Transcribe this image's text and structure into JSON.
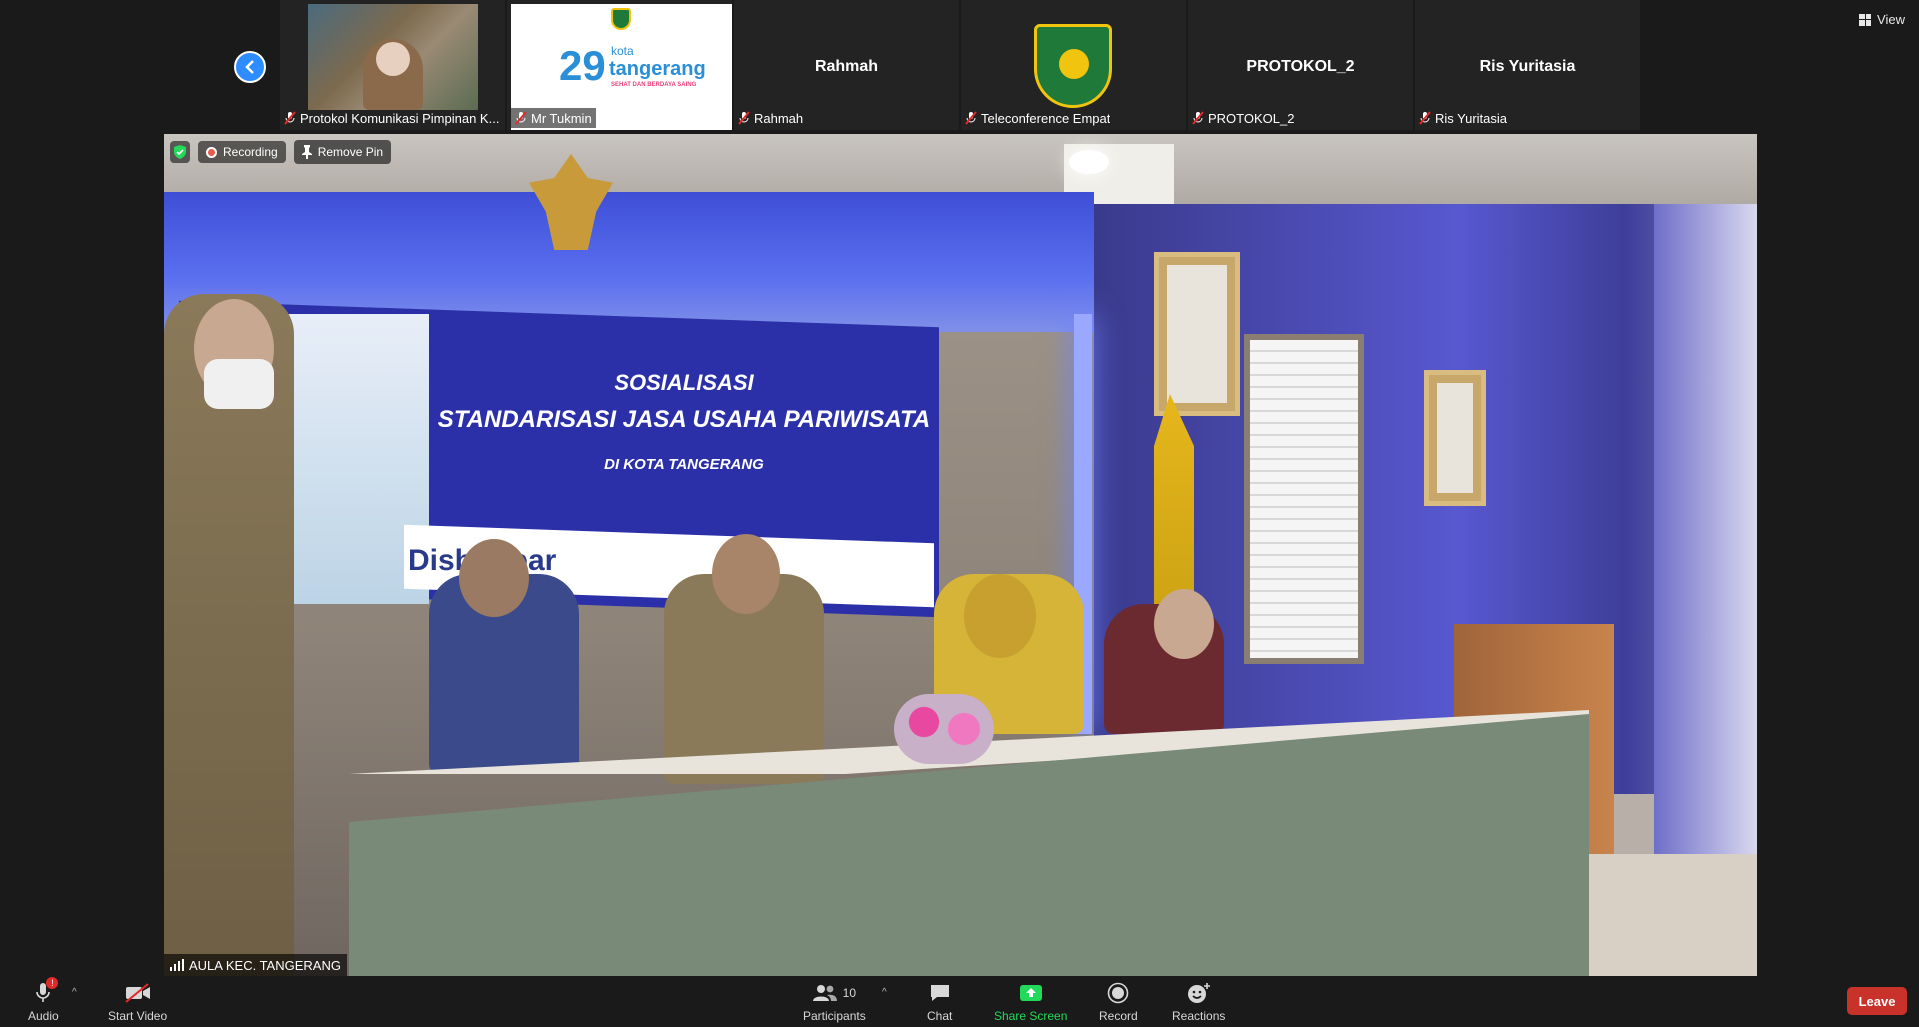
{
  "top_bar": {
    "view_label": "View"
  },
  "participants_strip": [
    {
      "name": "Protokol Komunikasi Pimpinan K...",
      "type": "video"
    },
    {
      "name": "Mr Tukmin",
      "type": "brand",
      "brand_small": "kota",
      "brand_main": "tangerang",
      "brand_sub": "SEHAT DAN BERDAYA SAING"
    },
    {
      "name": "Rahmah",
      "display": "Rahmah",
      "type": "name"
    },
    {
      "name": "Teleconference Empat",
      "type": "logo"
    },
    {
      "name": "PROTOKOL_2",
      "display": "PROTOKOL_2",
      "type": "name"
    },
    {
      "name": "Ris Yuritasia",
      "display": "Ris Yuritasia",
      "type": "name"
    }
  ],
  "main_video": {
    "recording_label": "Recording",
    "remove_pin_label": "Remove Pin",
    "speaker_name": "AULA KEC. TANGERANG",
    "banner_line1": "SOSIALISASI",
    "banner_line2": "STANDARISASI JASA USAHA PARIWISATA",
    "banner_line3": "DI KOTA TANGERANG",
    "banner_logo": "Disbudpar"
  },
  "toolbar": {
    "audio_label": "Audio",
    "audio_badge": "!",
    "video_label": "Start Video",
    "participants_label": "Participants",
    "participants_count": "10",
    "chat_label": "Chat",
    "share_label": "Share Screen",
    "record_label": "Record",
    "reactions_label": "Reactions",
    "leave_label": "Leave"
  },
  "colors": {
    "accent_blue": "#2d8cff",
    "share_green": "#23d959",
    "leave_red": "#c8322a",
    "recording_red": "#e85a4f"
  }
}
